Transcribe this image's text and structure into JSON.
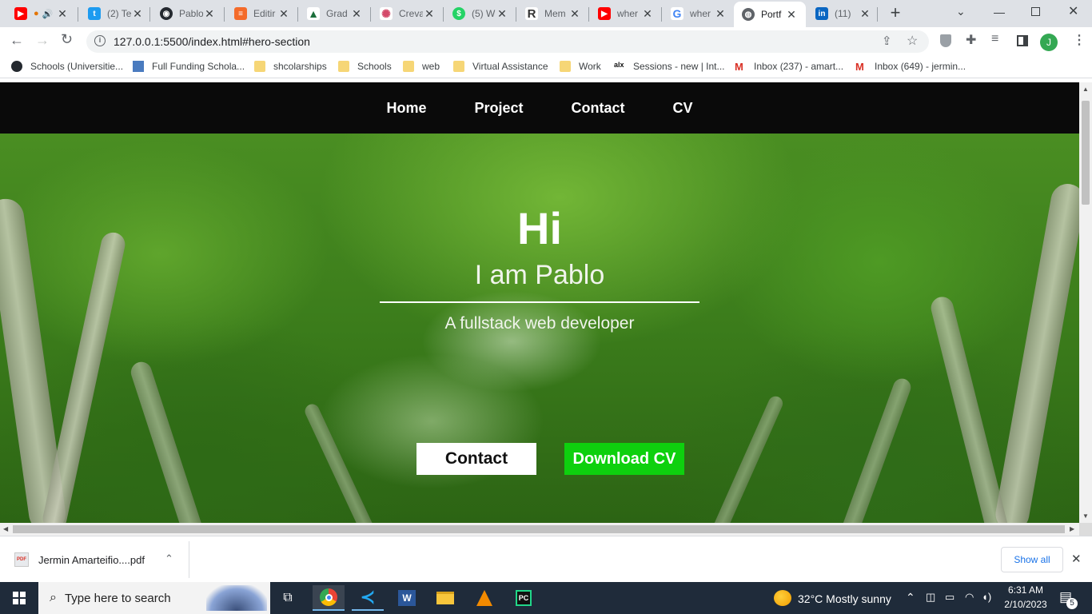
{
  "tabs": [
    {
      "title": "",
      "color": "#ff0000",
      "icon": "youtube-icon"
    },
    {
      "title": "(2) Te",
      "color": "#1d9bf0",
      "icon": "twitter-icon"
    },
    {
      "title": "Pablo",
      "color": "#24292f",
      "icon": "github-icon"
    },
    {
      "title": "Editir",
      "color": "#f46b2a",
      "icon": "edit-icon"
    },
    {
      "title": "Grad",
      "color": "#1b6e3b",
      "icon": "grade-icon"
    },
    {
      "title": "Creva",
      "color": "#d44a6a",
      "icon": "gear-icon"
    },
    {
      "title": "(5) W",
      "color": "#25d366",
      "icon": "whatsapp-icon"
    },
    {
      "title": "Mem",
      "color": "#333333",
      "icon": "r-icon"
    },
    {
      "title": "wher",
      "color": "#ff0000",
      "icon": "youtube-icon"
    },
    {
      "title": "wher",
      "color": "#4285f4",
      "icon": "google-icon"
    },
    {
      "title": "Portf",
      "color": "#5f6368",
      "icon": "globe-icon"
    },
    {
      "title": "(11)",
      "color": "#0a66c2",
      "icon": "linkedin-icon"
    }
  ],
  "address": {
    "url": "127.0.0.1:5500/index.html#hero-section"
  },
  "profile_initial": "J",
  "bookmarks": [
    "Schools (Universitie...",
    "Full Funding Schola...",
    "shcolarships",
    "Schools",
    "web",
    "Virtual Assistance",
    "Work",
    "Sessions - new | Int...",
    "Inbox (237) - amart...",
    "Inbox (649) - jermin..."
  ],
  "nav": {
    "home": "Home",
    "project": "Project",
    "contact": "Contact",
    "cv": "CV"
  },
  "hero": {
    "title": "Hi",
    "name": "I am Pablo",
    "subtitle": "A fullstack web developer",
    "contact_button": "Contact",
    "cv_button": "Download CV"
  },
  "download": {
    "filename": "Jermin Amarteifio....pdf",
    "show_all": "Show all",
    "badge": "PDF"
  },
  "taskbar": {
    "search_placeholder": "Type here to search",
    "weather": "32°C  Mostly sunny",
    "time": "6:31 AM",
    "date": "2/10/2023",
    "notifications": "5"
  },
  "colors": {
    "cv_button": "#0ed00e",
    "nav_bg": "#0a0a0a",
    "taskbar": "#1f2b3a"
  }
}
